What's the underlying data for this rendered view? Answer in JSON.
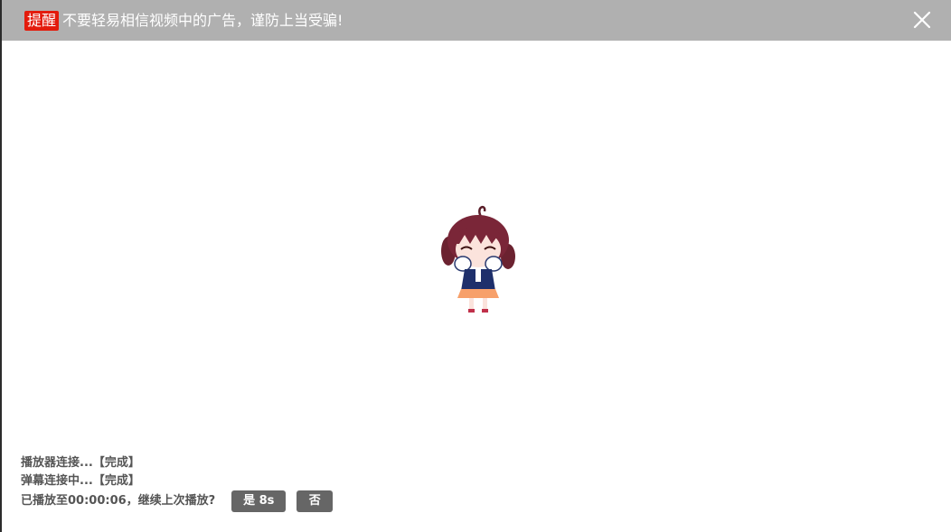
{
  "notice": {
    "tag": "提醒",
    "message": "不要轻易相信视频中的广告，谨防上当受骗!",
    "tag_color": "#e31b0c",
    "bar_color": "#b0b0b0",
    "close_icon": "close-icon"
  },
  "player": {
    "loading_icon": "anime-girl-mascot",
    "status_lines": [
      "播放器连接...【完成】",
      "弹幕连接中...【完成】"
    ],
    "resume_prompt": "已播放至00:00:06，继续上次播放?",
    "yes_label": "是 8s",
    "no_label": "否"
  }
}
